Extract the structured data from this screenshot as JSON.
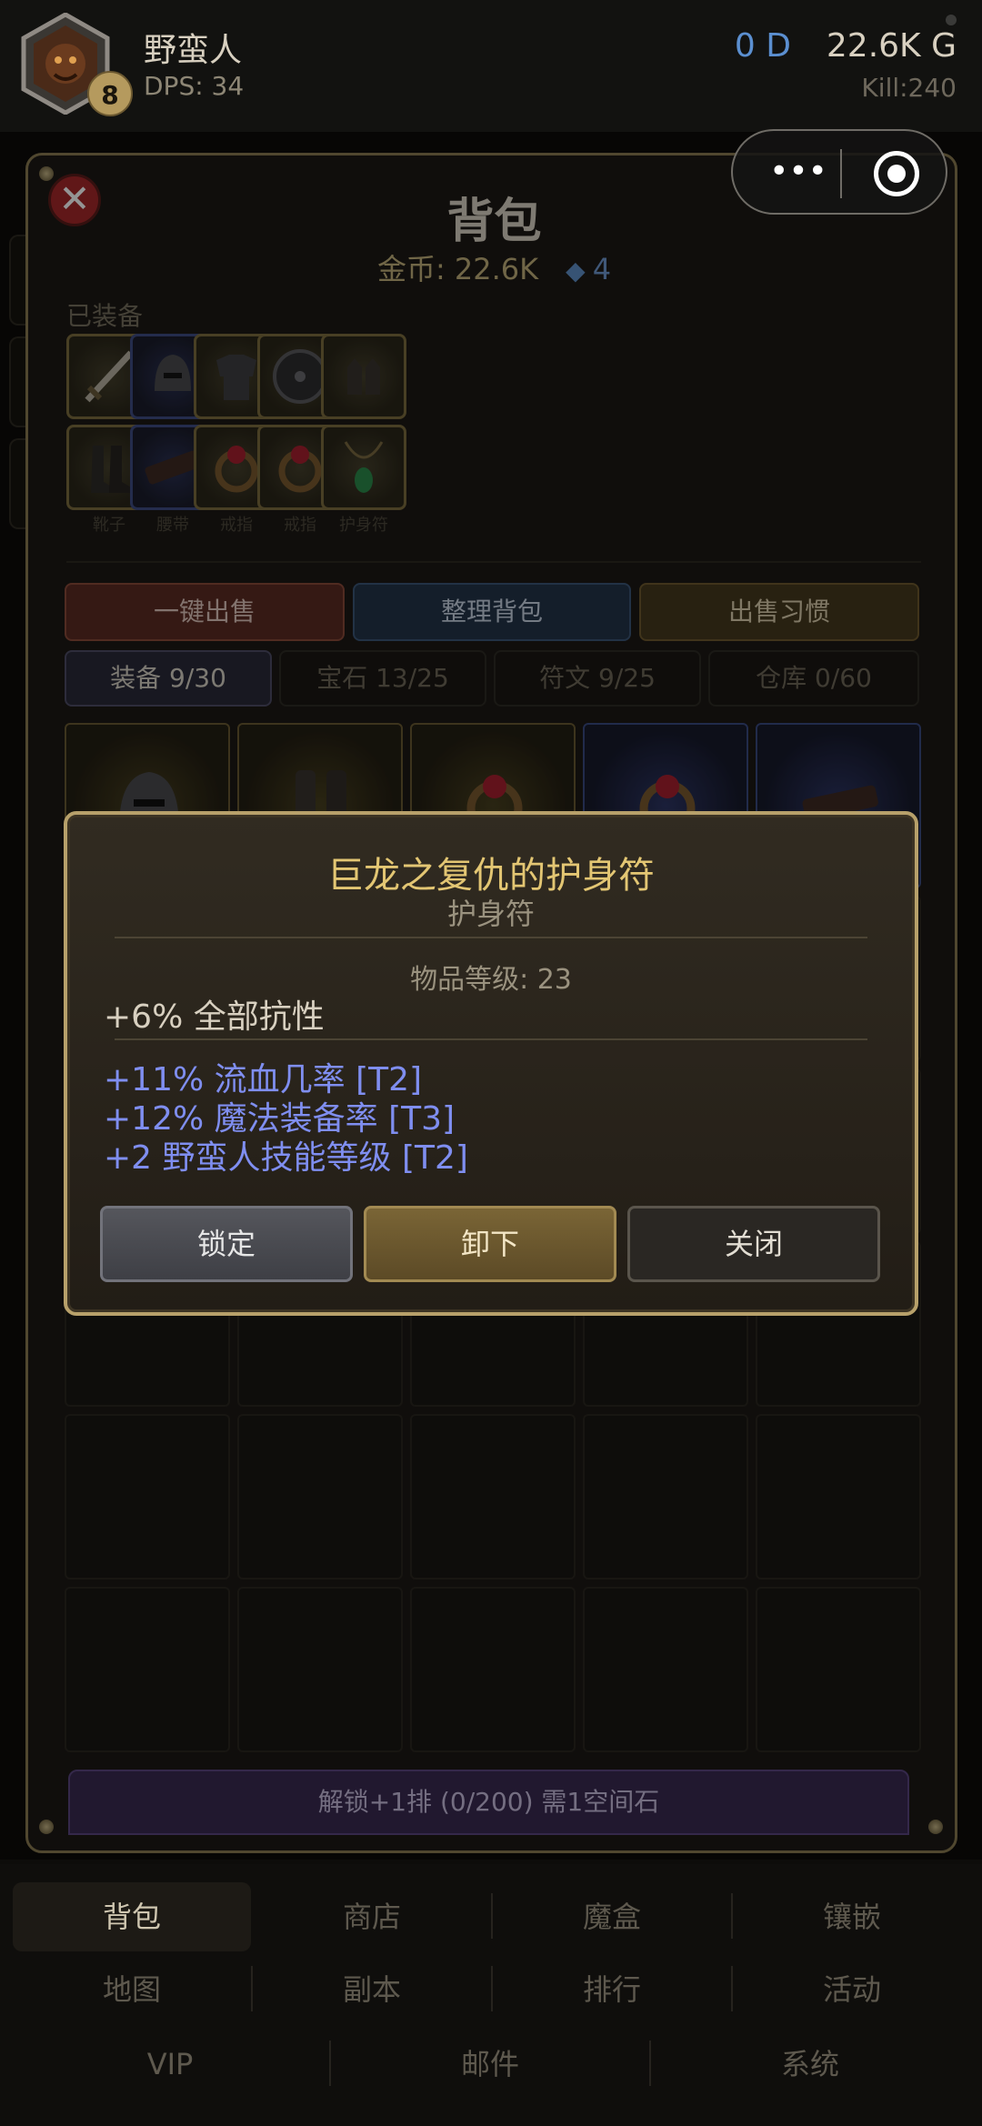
{
  "header": {
    "player_name": "野蛮人",
    "level": "8",
    "dps": "DPS: 34",
    "diamonds": "0 D",
    "gold": "22.6K G",
    "kills": "Kill:240"
  },
  "capsule": {
    "more_glyph": "•••"
  },
  "bag": {
    "title": "背包",
    "close_glyph": "✕",
    "coins_label": "金币: 22.6K",
    "gem_icon": "◆",
    "gem_count": "4",
    "equipped_label": "已装备",
    "slot_captions": [
      "靴子",
      "腰带",
      "戒指",
      "戒指",
      "护身符"
    ],
    "actions": {
      "sell_all": "一键出售",
      "sort": "整理背包",
      "habit": "出售习惯"
    },
    "tabs": [
      {
        "label": "装备 9/30",
        "active": true
      },
      {
        "label": "宝石 13/25",
        "active": false
      },
      {
        "label": "符文 9/25",
        "active": false
      },
      {
        "label": "仓库 0/60",
        "active": false
      }
    ],
    "unlock_label": "解锁+1排 (0/200) 需1空间石"
  },
  "item_tooltip": {
    "name": "巨龙之复仇的护身符",
    "type": "护身符",
    "item_level": "物品等级: 23",
    "implicit": "+6% 全部抗性",
    "affixes": [
      "+11% 流血几率 [T2]",
      "+12% 魔法装备率 [T3]",
      "+2 野蛮人技能等级 [T2]"
    ],
    "buttons": {
      "lock": "锁定",
      "unequip": "卸下",
      "close": "关闭"
    }
  },
  "bottom_nav": {
    "row1": [
      "背包",
      "商店",
      "魔盒",
      "镶嵌"
    ],
    "row2": [
      "地图",
      "副本",
      "排行",
      "活动"
    ],
    "row3": [
      "VIP",
      "邮件",
      "系统"
    ]
  },
  "colors": {
    "accent_gold": "#b7a06a",
    "affix_blue": "#7f8ef0",
    "title_gold": "#e3c673",
    "sell_red": "#5c2c24",
    "sort_blue": "#243449"
  }
}
